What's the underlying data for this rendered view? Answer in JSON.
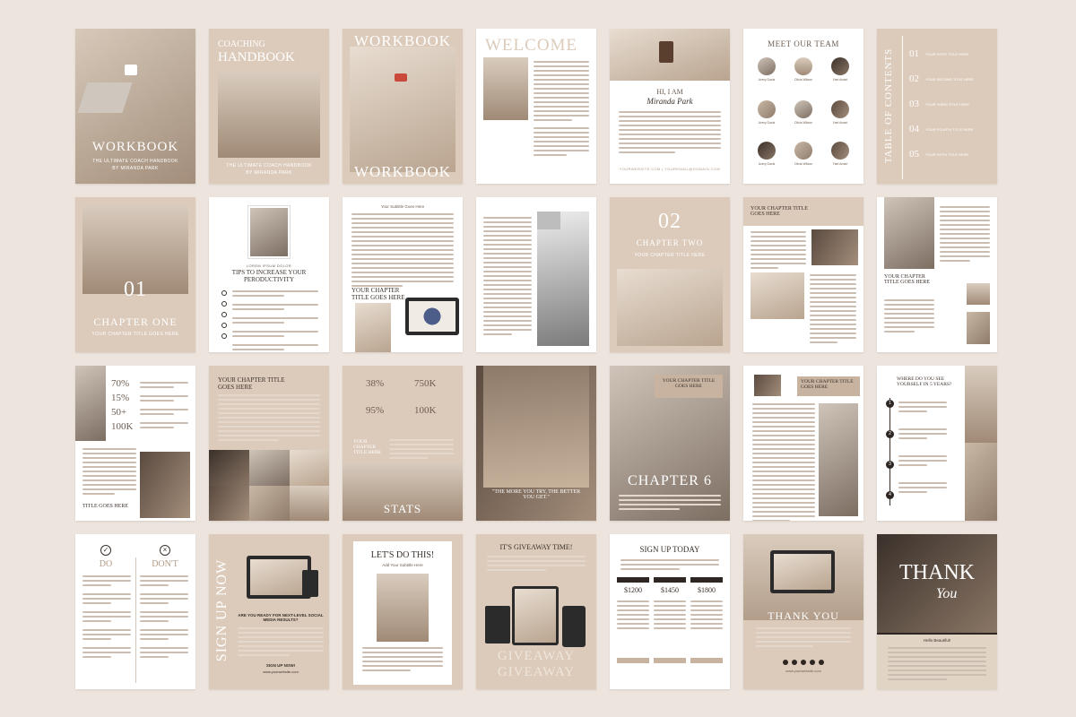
{
  "pages": {
    "p01": {
      "title": "WORKBOOK",
      "subtitle": "THE ULTIMATE COACH HANDBOOK",
      "author": "BY MIRANDA PARK"
    },
    "p02": {
      "title_top": "COACHING",
      "title_main": "HANDBOOK",
      "subtitle": "THE ULTIMATE COACH HANDBOOK",
      "author": "BY MIRANDA PARK"
    },
    "p03": {
      "title_top": "WORKBOOK",
      "title_bottom": "WORKBOOK"
    },
    "p04": {
      "title": "WELCOME"
    },
    "p05": {
      "greeting": "HI, I AM",
      "name": "Miranda Park",
      "footer": "yourwebsite.com | youremail@domain.com"
    },
    "p06": {
      "title": "MEET OUR TEAM",
      "members": [
        "Avery Davis",
        "Olivia Wilson",
        "Yael Amari",
        "Avery Davis",
        "Olivia Wilson",
        "Yael Amari",
        "Avery Davis",
        "Olivia Wilson",
        "Yael Amari"
      ]
    },
    "p07": {
      "title": "TABLE OF CONTENTS",
      "items": [
        {
          "num": "01",
          "label": "YOUR FIRST TITLE HERE"
        },
        {
          "num": "02",
          "label": "YOUR SECOND TITLE HERE"
        },
        {
          "num": "03",
          "label": "YOUR THIRD TITLE HERE"
        },
        {
          "num": "04",
          "label": "YOUR FOURTH TITLE HERE"
        },
        {
          "num": "05",
          "label": "YOUR FIFTH TITLE HERE"
        }
      ]
    },
    "p08": {
      "num": "01",
      "title": "CHAPTER ONE",
      "subtitle": "YOUR CHAPTER TITLE GOES HERE"
    },
    "p09": {
      "kicker": "LOREM IPSUM DOLOR",
      "title": "TIPS TO INCREASE YOUR PERODUCTIVITY"
    },
    "p10": {
      "subtitle": "Your Subtitle Goes Here",
      "title": "YOUR CHAPTER TITLE GOES HERE"
    },
    "p12": {
      "num": "02",
      "title": "CHAPTER TWO",
      "subtitle": "YOUR CHAPTER TITLE HERE"
    },
    "p13": {
      "title": "YOUR CHAPTER TITLE GOES HERE"
    },
    "p14": {
      "title": "YOUR CHAPTER TITLE GOES HERE"
    },
    "p15": {
      "stats": [
        "70%",
        "15%",
        "50+",
        "100K"
      ],
      "footer": "TITLE GOES HERE"
    },
    "p16": {
      "title": "YOUR CHAPTER TITLE GOES HERE"
    },
    "p17": {
      "stats": [
        "38%",
        "750K",
        "95%",
        "100K"
      ],
      "side_title": "YOUR CHAPTER TITLE HERE",
      "footer": "STATS"
    },
    "p18": {
      "quote": "\"THE MORE YOU TRY, THE BETTER YOU GET.\""
    },
    "p19": {
      "title": "YOUR CHAPTER TITLE GOES HERE",
      "chapter": "CHAPTER 6"
    },
    "p20": {
      "title": "YOUR CHAPTER TITLE GOES HERE"
    },
    "p21": {
      "title": "WHERE DO YOU SEE YOURSELF IN 5 YEARS?",
      "steps": [
        "1",
        "2",
        "3",
        "4"
      ]
    },
    "p22": {
      "do": "DO",
      "dont": "DON'T"
    },
    "p23": {
      "vertical": "SIGN UP NOW",
      "question": "ARE YOU READY FOR NEXT-LEVEL SOCIAL MEDIA RESULTS?",
      "cta": "SIGN UP NOW!",
      "url": "www.yourwebsite.com"
    },
    "p24": {
      "title": "LET'S DO THIS!",
      "subtitle": "Add Your Subtitle Here"
    },
    "p25": {
      "title": "IT'S GIVEAWAY TIME!",
      "footer1": "GIVEAWAY",
      "footer2": "GIVEAWAY"
    },
    "p26": {
      "title": "SIGN UP TODAY",
      "prices": [
        "$1200",
        "$1450",
        "$1800"
      ]
    },
    "p27": {
      "title": "THANK YOU",
      "url": "www.yourwebsite.com"
    },
    "p28": {
      "title": "THANK",
      "script": "You",
      "sub": "Hello Beautiful!"
    }
  }
}
